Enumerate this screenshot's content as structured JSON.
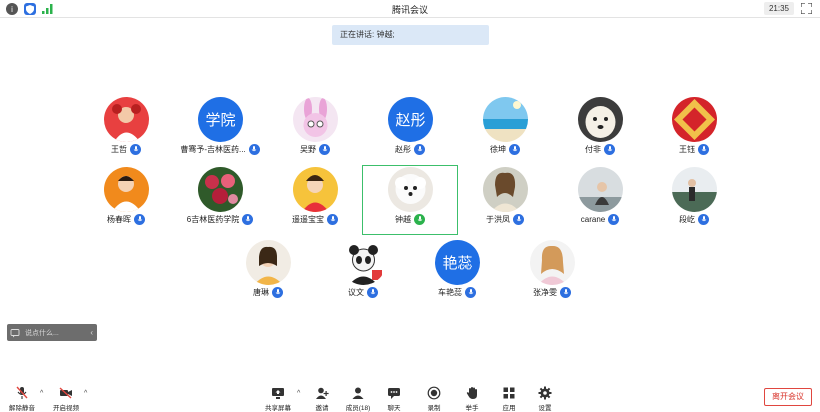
{
  "window": {
    "title": "腾讯会议",
    "time": "21:35"
  },
  "banner": {
    "speaking_text": "正在讲话: 钟越;"
  },
  "participants": [
    {
      "name": "王哲",
      "avatar_type": "photo",
      "mic": "on"
    },
    {
      "name": "曹骞予-吉林医药...",
      "avatar_type": "text",
      "avatar_text": "学院",
      "mic": "on"
    },
    {
      "name": "吴野",
      "avatar_type": "photo",
      "mic": "on"
    },
    {
      "name": "赵彤",
      "avatar_type": "text",
      "avatar_text": "赵彤",
      "mic": "on"
    },
    {
      "name": "徐坤",
      "avatar_type": "photo",
      "mic": "on"
    },
    {
      "name": "付非",
      "avatar_type": "photo",
      "mic": "on"
    },
    {
      "name": "王钰",
      "avatar_type": "photo",
      "mic": "on"
    },
    {
      "name": "杨春晖",
      "avatar_type": "photo",
      "mic": "on"
    },
    {
      "name": "6吉林医药学院",
      "avatar_type": "photo",
      "mic": "on"
    },
    {
      "name": "遥遥宝宝",
      "avatar_type": "photo",
      "mic": "on"
    },
    {
      "name": "钟越",
      "avatar_type": "photo",
      "mic": "speaking"
    },
    {
      "name": "于洪凤",
      "avatar_type": "photo",
      "mic": "on"
    },
    {
      "name": "carane",
      "avatar_type": "photo",
      "mic": "on"
    },
    {
      "name": "段屹",
      "avatar_type": "photo",
      "mic": "on"
    },
    {
      "name": "唐琳",
      "avatar_type": "photo",
      "mic": "on"
    },
    {
      "name": "议文",
      "avatar_type": "photo",
      "mic": "on"
    },
    {
      "name": "车艳蕊",
      "avatar_type": "text",
      "avatar_text": "艳蕊",
      "mic": "on"
    },
    {
      "name": "张净雯",
      "avatar_type": "photo",
      "mic": "on"
    }
  ],
  "chat": {
    "placeholder": "说点什么..."
  },
  "toolbar": {
    "unmute": "解除静音",
    "start_video": "开启视频",
    "share_screen": "共享屏幕",
    "invite": "邀请",
    "members": "成员(18)",
    "chat": "聊天",
    "record": "录制",
    "raise_hand": "举手",
    "apps": "应用",
    "settings": "设置",
    "leave": "离开会议"
  },
  "colors": {
    "accent": "#1f6fe5",
    "speaking_green": "#3cbf6b",
    "leave_red": "#e0463f",
    "banner_bg": "#dbe8f7"
  }
}
